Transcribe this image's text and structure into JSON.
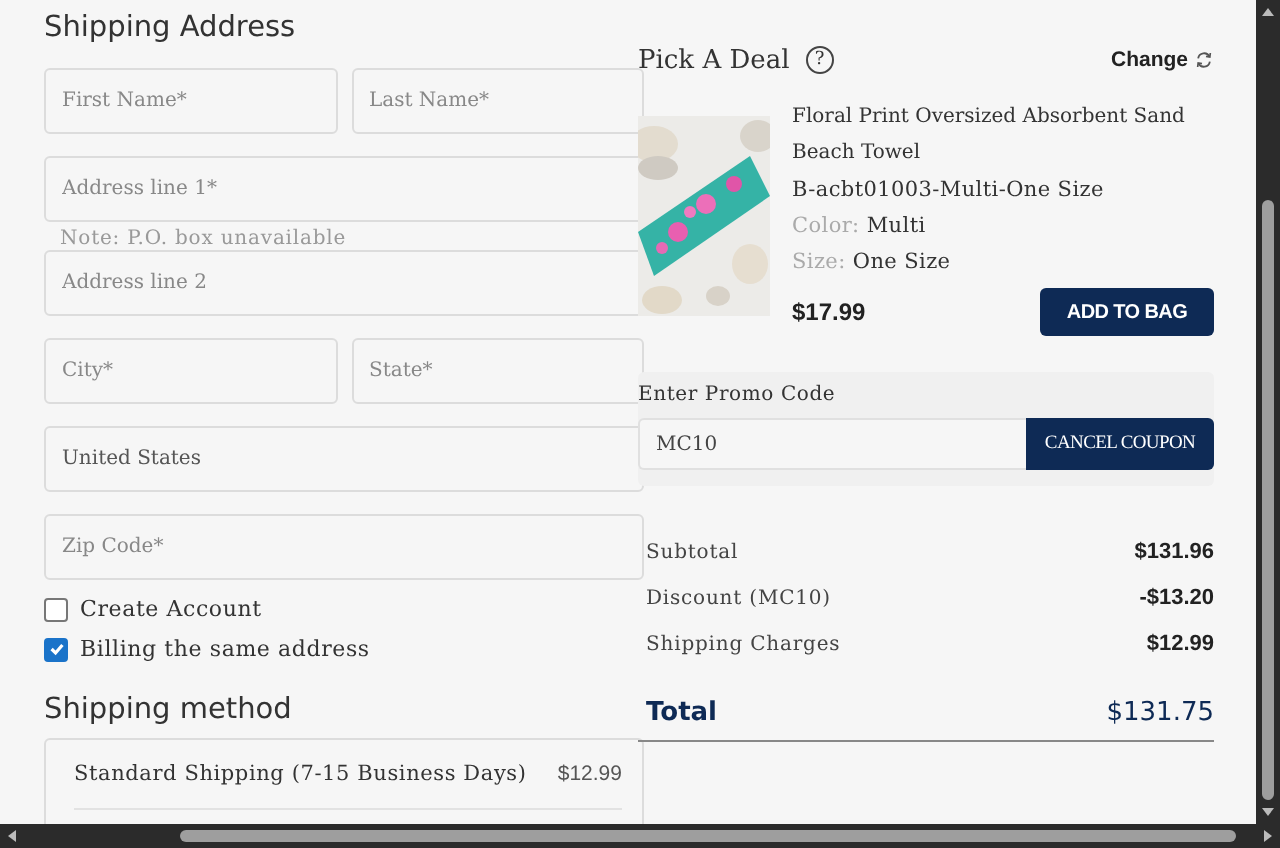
{
  "shipping_address": {
    "title": "Shipping Address",
    "rows": [
      [
        {
          "placeholder": "First Name*"
        },
        {
          "placeholder": "Last Name*"
        }
      ],
      [
        {
          "placeholder": "Address line 1*",
          "note": "Note: P.O. box unavailable"
        }
      ],
      [
        {
          "placeholder": "Address line 2"
        }
      ],
      [
        {
          "placeholder": "City*"
        },
        {
          "placeholder": "State*"
        }
      ],
      [
        {
          "value": "United States"
        }
      ],
      [
        {
          "placeholder": "Zip Code*"
        }
      ]
    ],
    "checkboxes": [
      {
        "label": "Create Account",
        "checked": false
      },
      {
        "label": "Billing the same address",
        "checked": true
      }
    ]
  },
  "shipping_method": {
    "title": "Shipping method",
    "options": [
      {
        "label": "Standard Shipping (7-15 Business Days)",
        "price": "$12.99"
      }
    ]
  },
  "deal": {
    "title": "Pick A Deal",
    "help": "?",
    "change": "Change",
    "product": {
      "name": "Floral Print Oversized Absorbent Sand Beach Towel",
      "sku": "B-acbt01003-Multi-One Size",
      "color_label": "Color:",
      "color_name": "Multi",
      "size_label": "Size:",
      "size": "One Size",
      "price": "$17.99",
      "button": "ADD TO BAG"
    }
  },
  "promo": {
    "label": "Enter Promo Code",
    "value": "MC10",
    "button": "CANCEL COUPON"
  },
  "summary": [
    {
      "label": "Subtotal",
      "value": "$131.96"
    },
    {
      "label": "Discount (MC10)",
      "value": "-$13.20"
    },
    {
      "label": "Shipping Charges",
      "value": "$12.99"
    }
  ],
  "total": {
    "label": "Total",
    "value": "$131.75"
  }
}
